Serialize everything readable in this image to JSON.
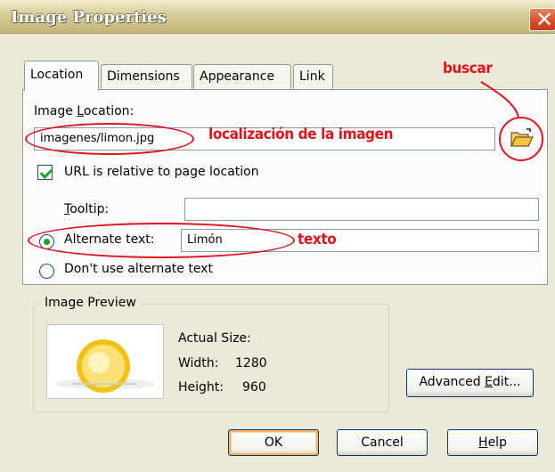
{
  "window": {
    "title": "Image Properties",
    "close_glyph": "✕"
  },
  "tabs": [
    {
      "label": "Location",
      "active": true
    },
    {
      "label": "Dimensions",
      "active": false
    },
    {
      "label": "Appearance",
      "active": false
    },
    {
      "label": "Link",
      "active": false
    }
  ],
  "location": {
    "image_location_label_pre": "Image ",
    "image_location_label_ul": "L",
    "image_location_label_post": "ocation:",
    "image_location_value": "imagenes/limon.jpg",
    "url_relative_label": "URL is relative to page location",
    "url_relative_checked": true,
    "tooltip_label_ul": "T",
    "tooltip_label_post": "ooltip:",
    "tooltip_value": "",
    "alternate_text_label": "Alternate text:",
    "alternate_text_value": "Limón",
    "alternate_text_selected": true,
    "no_alt_label": "Don't use alternate text",
    "browse_icon": "folder-open-icon"
  },
  "preview": {
    "legend": "Image Preview",
    "actual_size_label": "Actual Size:",
    "width_label": "Width:",
    "width_value": "1280",
    "height_label": "Height:",
    "height_value": "960"
  },
  "buttons": {
    "advanced_edit_pre": "Advanced ",
    "advanced_edit_ul": "E",
    "advanced_edit_post": "dit...",
    "ok": "OK",
    "cancel": "Cancel",
    "help_ul": "H",
    "help_post": "elp"
  },
  "annotations": {
    "buscar": "buscar",
    "localizacion": "localización de la imagen",
    "texto": "texto",
    "color": "#e0141b"
  }
}
